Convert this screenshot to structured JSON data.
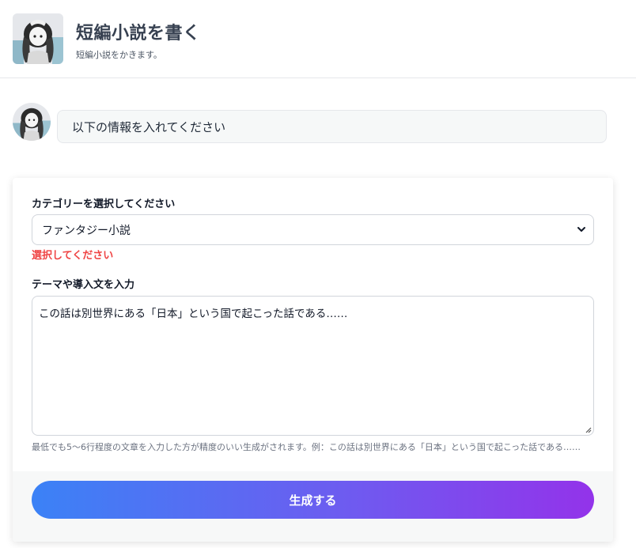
{
  "header": {
    "title": "短編小説を書く",
    "subtitle": "短編小説をかきます。",
    "avatar_icon": "anime-girl-avatar-icon"
  },
  "chat": {
    "avatar_icon": "anime-girl-avatar-icon",
    "message": "以下の情報を入れてください"
  },
  "form": {
    "category_label": "カテゴリーを選択してください",
    "category_value": "ファンタジー小説",
    "category_error": "選択してください",
    "theme_label": "テーマや導入文を入力",
    "theme_value": "この話は別世界にある「日本」という国で起こった話である……",
    "theme_hint": "最低でも5〜6行程度の文章を入力した方が精度のいい生成がされます。例：この話は別世界にある「日本」という国で起こった話である……",
    "submit_label": "生成する"
  },
  "colors": {
    "error": "#ef4444",
    "button_gradient_start": "#3b82f6",
    "button_gradient_end": "#9333ea"
  }
}
